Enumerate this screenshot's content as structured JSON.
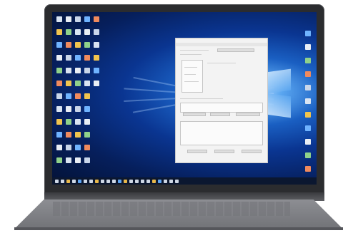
{
  "device": {
    "type": "laptop",
    "screen": {
      "wallpaper": "windows-10-light-blue",
      "accent_colors": {
        "wallpaper_glow": "#5aa6f0",
        "wallpaper_dark": "#061f5c",
        "taskbar": "#0b1730"
      }
    },
    "desktop_icons": {
      "left_columns": 5,
      "right_columns": 1
    },
    "window": {
      "type": "settings-dialog",
      "background": "#f3f3f3"
    },
    "taskbar": {
      "icon_count": 22
    }
  }
}
